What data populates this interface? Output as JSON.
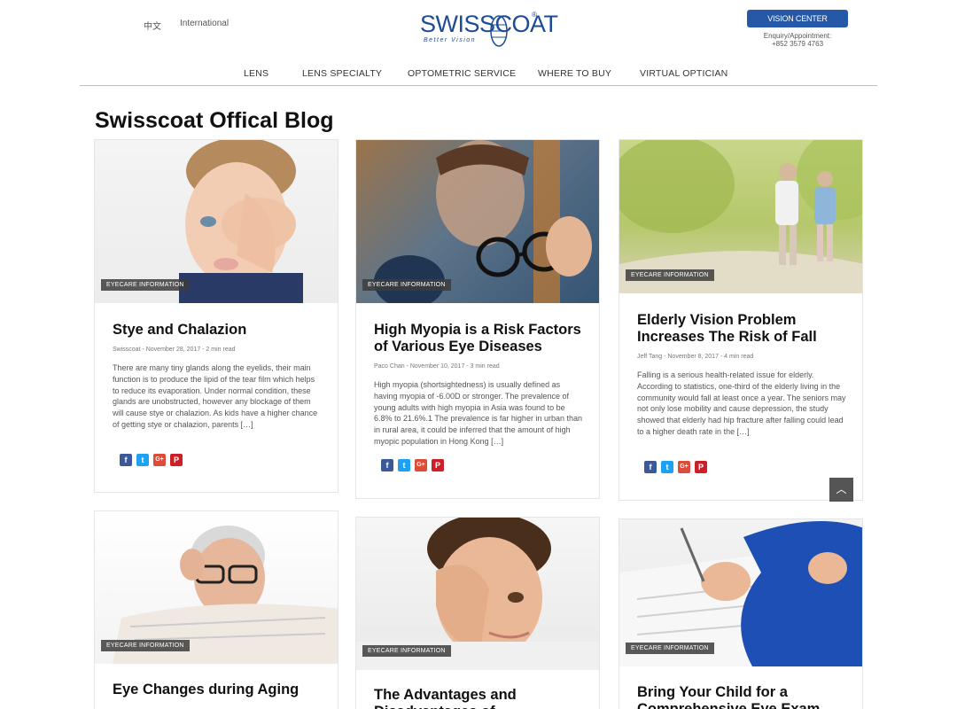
{
  "header": {
    "lang_zh": "中文",
    "lang_intl": "International",
    "logo_word": "SWISSCOAT",
    "logo_tagline": "Better Vision",
    "logo_reg": "®",
    "vision_center": "VISION CENTER",
    "enquiry_label": "Enquiry/Appointment:",
    "enquiry_phone": "+852 3579 4763",
    "brand_color": "#1c4c96",
    "button_color": "#2558a6"
  },
  "nav": {
    "items": [
      "LENS",
      "LENS SPECIALTY",
      "OPTOMETRIC SERVICE",
      "WHERE TO BUY",
      "VIRTUAL OPTICIAN"
    ]
  },
  "page": {
    "title": "Swisscoat Offical Blog"
  },
  "cards": [
    {
      "tag": "EYECARE INFORMATION",
      "title": "Stye and Chalazion",
      "meta": "Swisscoat - November 28, 2017 - 2 min read",
      "excerpt": "There are many tiny glands along the eyelids, their main function is to produce the lipid of the tear film which helps to reduce its evaporation. Under normal condition, these glands are unobstructed, however any blockage of them will cause stye or chalazion. As kids have a higher chance of getting stye or chalazion, parents […]",
      "image_desc": "child-rubbing-eye"
    },
    {
      "tag": "EYECARE INFORMATION",
      "title": "High Myopia is a Risk Factors of Various Eye Diseases",
      "meta": "Paco Chan - November 10, 2017 - 3 min read",
      "excerpt": "High myopia (shortsightedness) is usually defined as having myopia of -6.00D or stronger. The prevalence of young adults with high myopia in Asia was found to be 6.8% to 21.6%.1 The prevalence is far higher in urban than in rural area, it could be inferred that the amount of high myopic population in Hong Kong […]",
      "image_desc": "man-holding-glasses"
    },
    {
      "tag": "EYECARE INFORMATION",
      "title": "Elderly Vision Problem Increases The Risk of Fall",
      "meta": "Jeff Tang - November 8, 2017 - 4 min read",
      "excerpt": "Falling is a serious health-related issue for elderly. According to statistics, one-third of the elderly living in the community would fall at least once a year. The seniors may not only lose mobility and cause depression, the study showed that elderly had hip fracture after falling could lead to a higher death rate in the […]",
      "image_desc": "elderly-walking-park"
    },
    {
      "tag": "EYECARE INFORMATION",
      "title": "Eye Changes during Aging",
      "image_desc": "older-man-reading"
    },
    {
      "tag": "EYECARE INFORMATION",
      "title": "The Advantages and Disadvantages of",
      "image_desc": "child-covering-eye"
    },
    {
      "tag": "EYECARE INFORMATION",
      "title": "Bring Your Child for a Comprehensive Eye Exam",
      "image_desc": "child-writing"
    }
  ],
  "social": {
    "fb": "f",
    "tw": "t",
    "gp": "G+",
    "pi": "P"
  },
  "scroll_top": "︿"
}
